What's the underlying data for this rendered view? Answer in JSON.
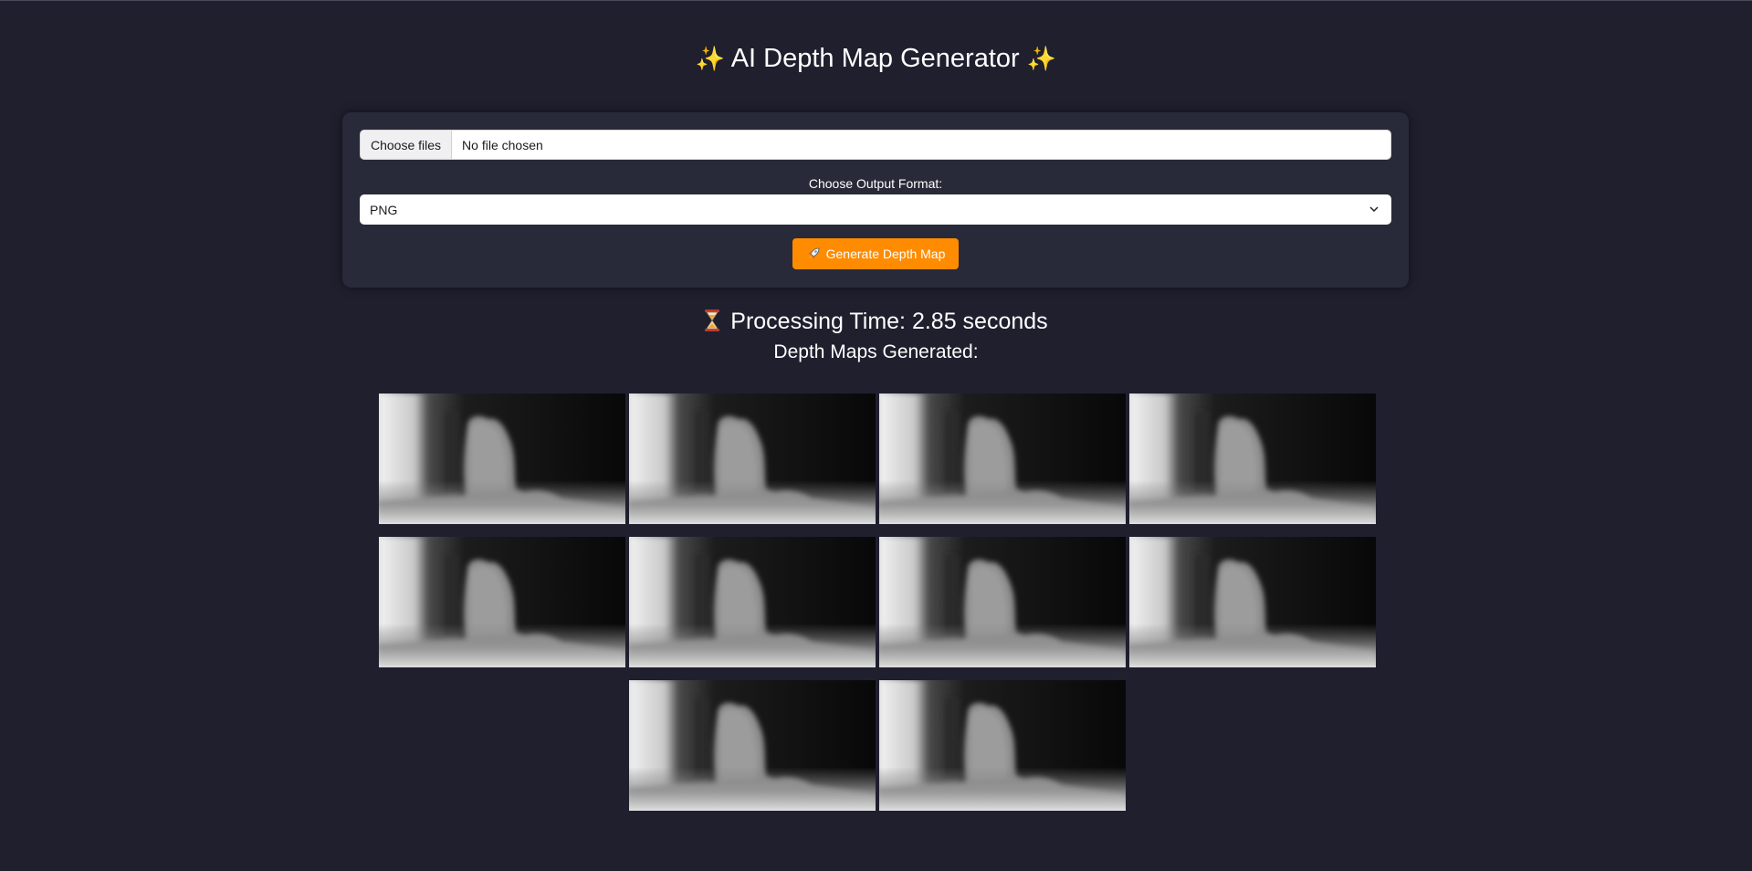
{
  "header": {
    "title": "AI Depth Map Generator",
    "title_emoji": "✨"
  },
  "form": {
    "file_button_label": "Choose files",
    "file_status": "No file chosen",
    "format_label": "Choose Output Format:",
    "format_selected": "PNG",
    "generate_label": "Generate Depth Map",
    "generate_icon": "rocket-icon",
    "accent_color": "#ff8c00"
  },
  "results": {
    "processing_time": "Processing Time: 2.85 seconds",
    "processing_icon": "hourglass-icon",
    "heading": "Depth Maps Generated:",
    "depth_map_count": 10
  },
  "colors": {
    "background": "#1f1f2e",
    "panel": "#282a39",
    "accent": "#ff8c00"
  }
}
